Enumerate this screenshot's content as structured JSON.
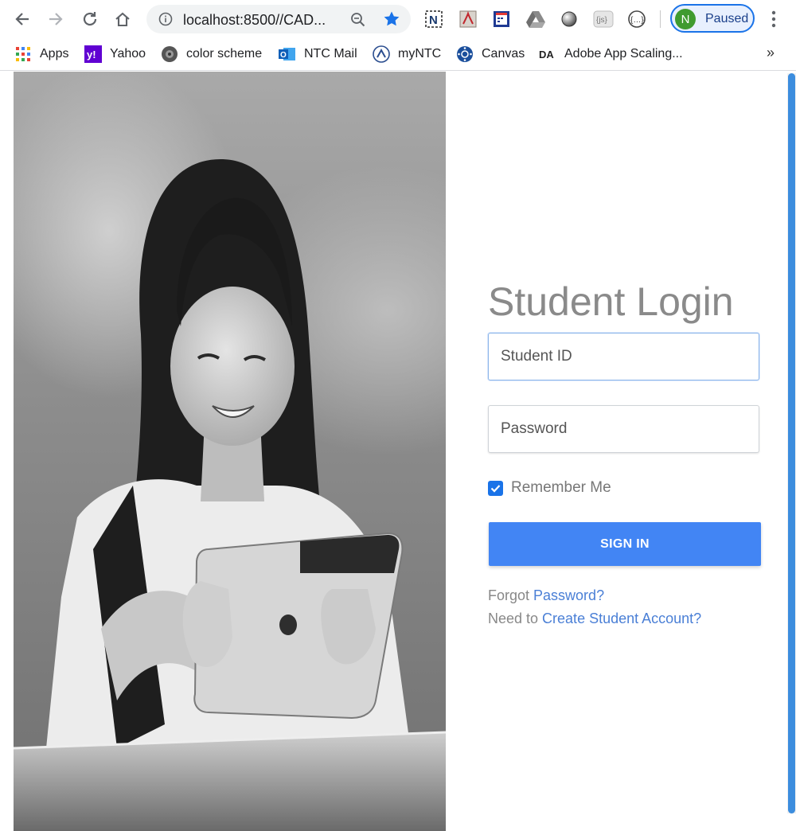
{
  "browser": {
    "url": "localhost:8500//CAD...",
    "profile": {
      "initial": "N",
      "status": "Paused"
    },
    "bookmarks": [
      {
        "label": "Apps",
        "icon": "apps-grid-icon"
      },
      {
        "label": "Yahoo",
        "icon": "yahoo-icon"
      },
      {
        "label": "color scheme",
        "icon": "color-scheme-icon"
      },
      {
        "label": "NTC Mail",
        "icon": "outlook-icon"
      },
      {
        "label": "myNTC",
        "icon": "myntc-icon"
      },
      {
        "label": "Canvas",
        "icon": "canvas-icon"
      },
      {
        "label": "Adobe App Scaling...",
        "icon": "adobe-da-icon"
      }
    ],
    "more_label": "»",
    "ext_texts": {
      "js": "{js}",
      "dev": "{…}"
    }
  },
  "login": {
    "title": "Student Login",
    "student_id_placeholder": "Student ID",
    "password_placeholder": "Password",
    "remember_me": "Remember Me",
    "remember_checked": true,
    "sign_in": "SIGN IN",
    "forgot_prefix": "Forgot ",
    "forgot_link": "Password?",
    "create_prefix": "Need to ",
    "create_link": "Create Student Account?"
  }
}
